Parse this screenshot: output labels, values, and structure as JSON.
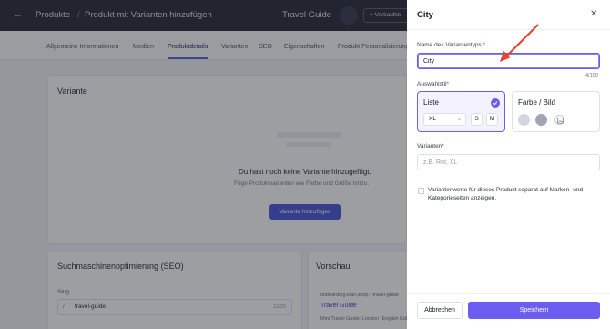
{
  "header": {
    "back_icon": "arrow-left-icon",
    "breadcrumb_root": "Produkte",
    "breadcrumb_sep": "/",
    "breadcrumb_current": "Produkt mit Varianten hinzufügen",
    "store_name": "Travel Guide",
    "sales_button": "+ Verkaufsk"
  },
  "tabs": [
    {
      "label": "Allgemeine Informationen"
    },
    {
      "label": "Medien"
    },
    {
      "label": "Produktdetails",
      "active": true
    },
    {
      "label": "Varianten"
    },
    {
      "label": "SEO"
    },
    {
      "label": "Eigenschaften"
    },
    {
      "label": "Produkt Personalisierung"
    }
  ],
  "variants_card": {
    "title": "Variante",
    "empty_title": "Du hast noch keine Variante hinzugefügt.",
    "empty_subtitle": "Füge Produktvarianten wie Farbe und Größe hinzu.",
    "add_button": "Variante hinzufügen"
  },
  "seo_card": {
    "title": "Suchmaschinenoptimierung (SEO)",
    "slug_label": "Slug",
    "slug_prefix": "/",
    "slug_value": "travel-guide",
    "slug_counter": "12/30"
  },
  "preview_card": {
    "title": "Vorschau",
    "url": "onboarding.kian.shop › travel-guide",
    "page_title": "Travel Guide",
    "description": "Mini Travel Guide: London (English Edition) ..."
  },
  "drawer": {
    "title": "City",
    "close_icon": "close-icon",
    "type_name_label": "Name des Variantentyps",
    "type_name_value": "City",
    "type_name_counter": "4/100",
    "style_label": "Auswahlstil",
    "style_list": {
      "title": "Liste",
      "selected": true,
      "dropdown_value": "XL",
      "sizes": [
        "S",
        "M"
      ]
    },
    "style_color": {
      "title": "Farbe / Bild",
      "swatches": [
        "#d3d6de",
        "#a1a6b4"
      ],
      "image_icon": "image-icon"
    },
    "variants_label": "Varianten",
    "variants_placeholder": "z.B. Rot, XL",
    "checkbox_label": "Variantenwerte für dieses Produkt separat auf Marken- und Kategorieseiten anzeigen.",
    "cancel_button": "Abbrechen",
    "save_button": "Speichern",
    "required_mark": "*"
  },
  "colors": {
    "accent": "#6c5cf0",
    "topbar": "#2b2d3c",
    "annotation_arrow": "#e8412c"
  }
}
